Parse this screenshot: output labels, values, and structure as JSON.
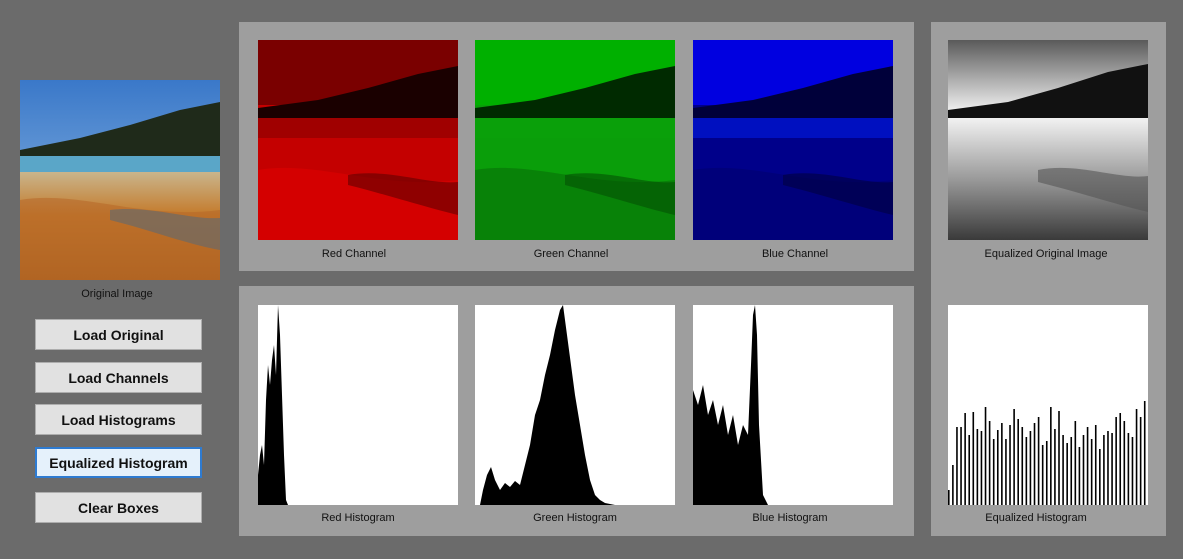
{
  "left": {
    "original_caption": "Original Image",
    "buttons": {
      "load_original": "Load Original",
      "load_channels": "Load Channels",
      "load_histograms": "Load Histograms",
      "equalized_histogram": "Equalized Histogram",
      "clear_boxes": "Clear Boxes"
    }
  },
  "channels": {
    "red_caption": "Red Channel",
    "green_caption": "Green Channel",
    "blue_caption": "Blue Channel"
  },
  "equalized": {
    "image_caption": "Equalized Original Image",
    "histogram_caption": "Equalized Histogram"
  },
  "histograms": {
    "red_caption": "Red Histogram",
    "green_caption": "Green Histogram",
    "blue_caption": "Blue Histogram"
  },
  "colors": {
    "background": "#6b6b6b",
    "panel": "#9e9e9e",
    "focus_border": "#2e7bd1"
  }
}
